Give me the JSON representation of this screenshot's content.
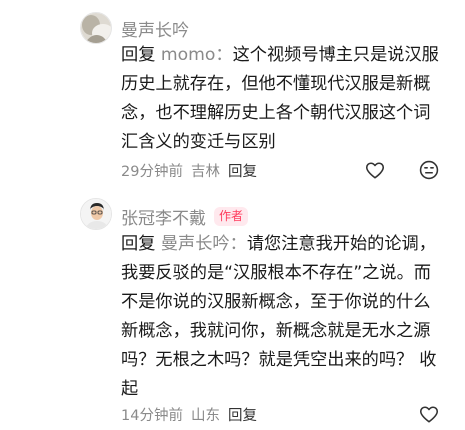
{
  "comments": [
    {
      "author": "曼声长吟",
      "reply_prefix": "回复",
      "reply_target": "momo：",
      "text": "这个视频号博主只是说汉服历史上就存在，但他不懂现代汉服是新概念，也不理解历史上各个朝代汉服这个词汇含义的变迁与区别",
      "time": "29分钟前",
      "location": "吉林",
      "reply_label": "回复",
      "icons": [
        "heart-icon",
        "dislike-face-icon"
      ]
    },
    {
      "author": "张冠李不戴",
      "badge": "作者",
      "reply_prefix": "回复",
      "reply_target": "曼声长吟：",
      "text": "请您注意我开始的论调，我要反驳的是“汉服根本不存在”之说。而不是你说的汉服新概念，至于你说的什么新概念，我就问你，新概念就是无水之源吗？无根之木吗？就是凭空出来的吗？",
      "collapse_label": "收起",
      "time": "14分钟前",
      "location": "山东",
      "reply_label": "回复",
      "icons": [
        "heart-icon"
      ]
    }
  ]
}
